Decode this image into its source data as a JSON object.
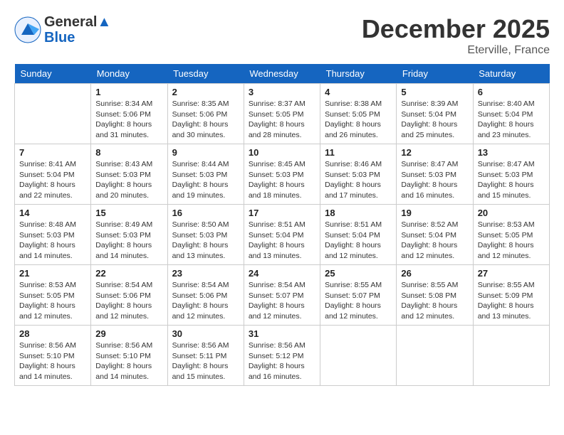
{
  "header": {
    "logo_line1": "General",
    "logo_line2": "Blue",
    "month": "December 2025",
    "location": "Eterville, France"
  },
  "weekdays": [
    "Sunday",
    "Monday",
    "Tuesday",
    "Wednesday",
    "Thursday",
    "Friday",
    "Saturday"
  ],
  "weeks": [
    [
      {
        "day": "",
        "info": ""
      },
      {
        "day": "1",
        "info": "Sunrise: 8:34 AM\nSunset: 5:06 PM\nDaylight: 8 hours\nand 31 minutes."
      },
      {
        "day": "2",
        "info": "Sunrise: 8:35 AM\nSunset: 5:06 PM\nDaylight: 8 hours\nand 30 minutes."
      },
      {
        "day": "3",
        "info": "Sunrise: 8:37 AM\nSunset: 5:05 PM\nDaylight: 8 hours\nand 28 minutes."
      },
      {
        "day": "4",
        "info": "Sunrise: 8:38 AM\nSunset: 5:05 PM\nDaylight: 8 hours\nand 26 minutes."
      },
      {
        "day": "5",
        "info": "Sunrise: 8:39 AM\nSunset: 5:04 PM\nDaylight: 8 hours\nand 25 minutes."
      },
      {
        "day": "6",
        "info": "Sunrise: 8:40 AM\nSunset: 5:04 PM\nDaylight: 8 hours\nand 23 minutes."
      }
    ],
    [
      {
        "day": "7",
        "info": "Sunrise: 8:41 AM\nSunset: 5:04 PM\nDaylight: 8 hours\nand 22 minutes."
      },
      {
        "day": "8",
        "info": "Sunrise: 8:43 AM\nSunset: 5:03 PM\nDaylight: 8 hours\nand 20 minutes."
      },
      {
        "day": "9",
        "info": "Sunrise: 8:44 AM\nSunset: 5:03 PM\nDaylight: 8 hours\nand 19 minutes."
      },
      {
        "day": "10",
        "info": "Sunrise: 8:45 AM\nSunset: 5:03 PM\nDaylight: 8 hours\nand 18 minutes."
      },
      {
        "day": "11",
        "info": "Sunrise: 8:46 AM\nSunset: 5:03 PM\nDaylight: 8 hours\nand 17 minutes."
      },
      {
        "day": "12",
        "info": "Sunrise: 8:47 AM\nSunset: 5:03 PM\nDaylight: 8 hours\nand 16 minutes."
      },
      {
        "day": "13",
        "info": "Sunrise: 8:47 AM\nSunset: 5:03 PM\nDaylight: 8 hours\nand 15 minutes."
      }
    ],
    [
      {
        "day": "14",
        "info": "Sunrise: 8:48 AM\nSunset: 5:03 PM\nDaylight: 8 hours\nand 14 minutes."
      },
      {
        "day": "15",
        "info": "Sunrise: 8:49 AM\nSunset: 5:03 PM\nDaylight: 8 hours\nand 14 minutes."
      },
      {
        "day": "16",
        "info": "Sunrise: 8:50 AM\nSunset: 5:03 PM\nDaylight: 8 hours\nand 13 minutes."
      },
      {
        "day": "17",
        "info": "Sunrise: 8:51 AM\nSunset: 5:04 PM\nDaylight: 8 hours\nand 13 minutes."
      },
      {
        "day": "18",
        "info": "Sunrise: 8:51 AM\nSunset: 5:04 PM\nDaylight: 8 hours\nand 12 minutes."
      },
      {
        "day": "19",
        "info": "Sunrise: 8:52 AM\nSunset: 5:04 PM\nDaylight: 8 hours\nand 12 minutes."
      },
      {
        "day": "20",
        "info": "Sunrise: 8:53 AM\nSunset: 5:05 PM\nDaylight: 8 hours\nand 12 minutes."
      }
    ],
    [
      {
        "day": "21",
        "info": "Sunrise: 8:53 AM\nSunset: 5:05 PM\nDaylight: 8 hours\nand 12 minutes."
      },
      {
        "day": "22",
        "info": "Sunrise: 8:54 AM\nSunset: 5:06 PM\nDaylight: 8 hours\nand 12 minutes."
      },
      {
        "day": "23",
        "info": "Sunrise: 8:54 AM\nSunset: 5:06 PM\nDaylight: 8 hours\nand 12 minutes."
      },
      {
        "day": "24",
        "info": "Sunrise: 8:54 AM\nSunset: 5:07 PM\nDaylight: 8 hours\nand 12 minutes."
      },
      {
        "day": "25",
        "info": "Sunrise: 8:55 AM\nSunset: 5:07 PM\nDaylight: 8 hours\nand 12 minutes."
      },
      {
        "day": "26",
        "info": "Sunrise: 8:55 AM\nSunset: 5:08 PM\nDaylight: 8 hours\nand 12 minutes."
      },
      {
        "day": "27",
        "info": "Sunrise: 8:55 AM\nSunset: 5:09 PM\nDaylight: 8 hours\nand 13 minutes."
      }
    ],
    [
      {
        "day": "28",
        "info": "Sunrise: 8:56 AM\nSunset: 5:10 PM\nDaylight: 8 hours\nand 14 minutes."
      },
      {
        "day": "29",
        "info": "Sunrise: 8:56 AM\nSunset: 5:10 PM\nDaylight: 8 hours\nand 14 minutes."
      },
      {
        "day": "30",
        "info": "Sunrise: 8:56 AM\nSunset: 5:11 PM\nDaylight: 8 hours\nand 15 minutes."
      },
      {
        "day": "31",
        "info": "Sunrise: 8:56 AM\nSunset: 5:12 PM\nDaylight: 8 hours\nand 16 minutes."
      },
      {
        "day": "",
        "info": ""
      },
      {
        "day": "",
        "info": ""
      },
      {
        "day": "",
        "info": ""
      }
    ]
  ]
}
